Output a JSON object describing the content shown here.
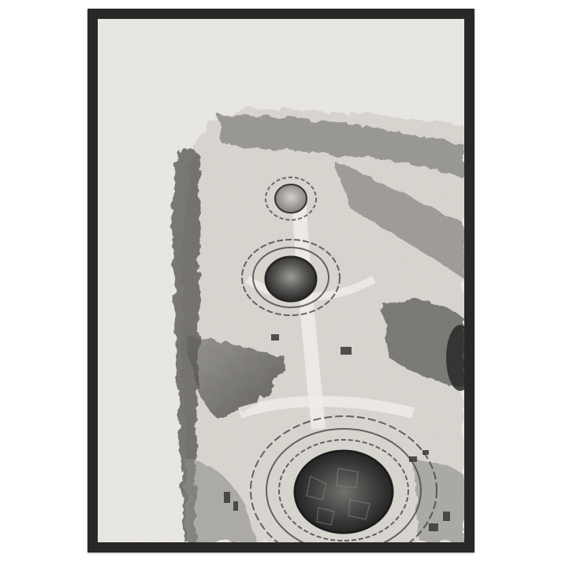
{
  "artwork": {
    "frame_color": "#2a2727",
    "paper_color": "#ebe9e3",
    "ink_color": "#3a3a3a",
    "subject": "framed-monochrome-print"
  }
}
